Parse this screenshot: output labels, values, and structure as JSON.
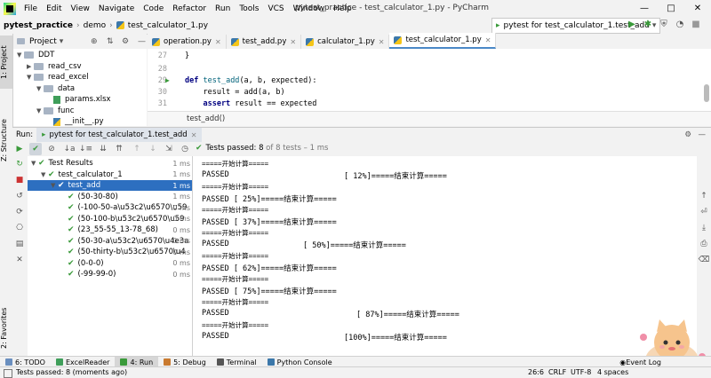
{
  "menubar": {
    "items": [
      "File",
      "Edit",
      "View",
      "Navigate",
      "Code",
      "Refactor",
      "Run",
      "Tools",
      "VCS",
      "Window",
      "Help"
    ],
    "title": "pytest_practice - test_calculator_1.py - PyCharm"
  },
  "navbar": {
    "crumbs": [
      "pytest_practice",
      "demo",
      "test_calculator_1.py"
    ],
    "run_config": "pytest for test_calculator_1.test_add"
  },
  "left_gutter": {
    "project_tab": "1: Project",
    "structure_tab": "Z: Structure",
    "favorites_tab": "2: Favorites"
  },
  "project": {
    "header": "Project",
    "tree": [
      {
        "label": "DDT",
        "level": 0,
        "kind": "folder",
        "open": true
      },
      {
        "label": "read_csv",
        "level": 1,
        "kind": "folder",
        "open": false
      },
      {
        "label": "read_excel",
        "level": 1,
        "kind": "folder",
        "open": true
      },
      {
        "label": "data",
        "level": 2,
        "kind": "folder",
        "open": true
      },
      {
        "label": "params.xlsx",
        "level": 3,
        "kind": "file",
        "open": false
      },
      {
        "label": "func",
        "level": 2,
        "kind": "folder",
        "open": true
      },
      {
        "label": "__init__.py",
        "level": 3,
        "kind": "file",
        "open": false
      }
    ]
  },
  "editor": {
    "tabs": [
      "operation.py",
      "test_add.py",
      "calculator_1.py",
      "test_calculator_1.py"
    ],
    "active_tab": 3,
    "lines": [
      {
        "num": "27",
        "code": "}"
      },
      {
        "num": "28",
        "code": ""
      },
      {
        "num": "29",
        "code": "def test_add(a, b, expected):"
      },
      {
        "num": "30",
        "code": "    result = add(a, b)"
      },
      {
        "num": "31",
        "code": "    assert result == expected"
      }
    ],
    "breadcrumb": "test_add()"
  },
  "run": {
    "label": "Run:",
    "tab": "pytest for test_calculator_1.test_add",
    "status_main": "Tests passed: 8",
    "status_rest": " of 8 tests – 1 ms",
    "tree": [
      {
        "label": "Test Results",
        "time": "1 ms",
        "level": 0,
        "arrow": true
      },
      {
        "label": "test_calculator_1",
        "time": "1 ms",
        "level": 1,
        "arrow": true
      },
      {
        "label": "test_add",
        "time": "1 ms",
        "level": 2,
        "arrow": true
      },
      {
        "label": "(50-30-80)",
        "time": "1 ms",
        "level": 3,
        "arrow": false
      },
      {
        "label": "(-100-50-a\\u53c2\\u6570\\u59",
        "time": "0 ms",
        "level": 3,
        "arrow": false
      },
      {
        "label": "(50-100-b\\u53c2\\u6570\\u59",
        "time": "0 ms",
        "level": 3,
        "arrow": false
      },
      {
        "label": "(23_55-55_13-78_68)",
        "time": "0 ms",
        "level": 3,
        "arrow": false
      },
      {
        "label": "(50-30-a\\u53c2\\u6570\\u4e3a",
        "time": "0 ms",
        "level": 3,
        "arrow": false
      },
      {
        "label": "(50-thirty-b\\u53c2\\u6570\\u4",
        "time": "0 ms",
        "level": 3,
        "arrow": false
      },
      {
        "label": "(0-0-0)",
        "time": "0 ms",
        "level": 3,
        "arrow": false
      },
      {
        "label": "(-99-99-0)",
        "time": "0 ms",
        "level": 3,
        "arrow": false
      }
    ],
    "selected_index": 2,
    "console": [
      {
        "text": "=====开始计算=====",
        "small": true,
        "indent": 0
      },
      {
        "text": "PASSED",
        "small": false,
        "indent": 0,
        "suffix": "[ 12%]=====结束计算=====",
        "suffix_at": 160
      },
      {
        "text": "=====开始计算=====",
        "small": true,
        "indent": 0
      },
      {
        "text": "PASSED [ 25%]=====结束计算=====",
        "small": false,
        "indent": 0
      },
      {
        "text": "=====开始计算=====",
        "small": true,
        "indent": 0
      },
      {
        "text": "PASSED [ 37%]=====结束计算=====",
        "small": false,
        "indent": 0
      },
      {
        "text": "=====开始计算=====",
        "small": true,
        "indent": 0
      },
      {
        "text": "PASSED",
        "small": false,
        "indent": 0,
        "suffix": "[ 50%]=====结束计算=====",
        "suffix_at": 114
      },
      {
        "text": "=====开始计算=====",
        "small": true,
        "indent": 0
      },
      {
        "text": "PASSED [ 62%]=====结束计算=====",
        "small": false,
        "indent": 0
      },
      {
        "text": "=====开始计算=====",
        "small": true,
        "indent": 0
      },
      {
        "text": "PASSED [ 75%]=====结束计算=====",
        "small": false,
        "indent": 0
      },
      {
        "text": "=====开始计算=====",
        "small": true,
        "indent": 0
      },
      {
        "text": "PASSED",
        "small": false,
        "indent": 0,
        "suffix": "[ 87%]=====结束计算=====",
        "suffix_at": 174
      },
      {
        "text": "=====开始计算=====",
        "small": true,
        "indent": 0
      },
      {
        "text": "PASSED",
        "small": false,
        "indent": 0,
        "suffix": "[100%]=====结束计算=====",
        "suffix_at": 160
      }
    ]
  },
  "bottom_tabs": [
    {
      "label": "6: TODO",
      "icon": "todo-icon",
      "color": "#6a8fbf"
    },
    {
      "label": "ExcelReader",
      "icon": "excelreader-icon",
      "color": "#3f9e5a"
    },
    {
      "label": "4: Run",
      "icon": "run-icon",
      "color": "#3a9a3a"
    },
    {
      "label": "5: Debug",
      "icon": "debug-icon",
      "color": "#c97a2f"
    },
    {
      "label": "Terminal",
      "icon": "terminal-icon",
      "color": "#555555"
    },
    {
      "label": "Python Console",
      "icon": "python-console-icon",
      "color": "#3c78aa"
    }
  ],
  "event_log": "Event Log",
  "status": {
    "message": "Tests passed: 8 (moments ago)",
    "position": "26:6",
    "line_sep": "CRLF",
    "encoding": "UTF-8",
    "indent": "4 spaces"
  },
  "colors": {
    "accent": "#2d6fc0",
    "pass": "#3a9a3a"
  }
}
